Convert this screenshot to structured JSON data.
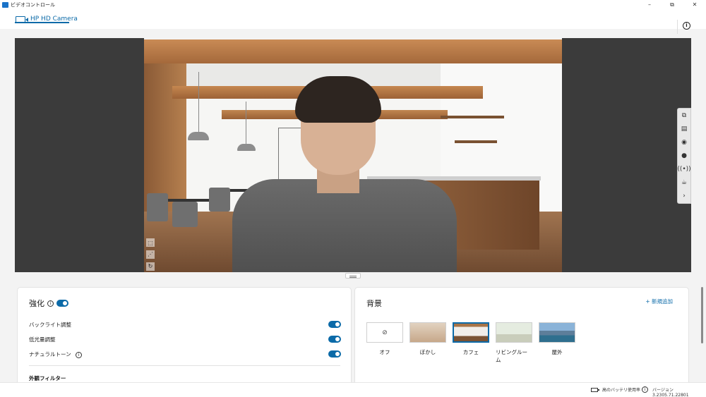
{
  "window": {
    "title": "ビデオコントロール",
    "minimize": "–",
    "maximize": "⧉",
    "close": "✕"
  },
  "tab": {
    "label": "HP HD Camera"
  },
  "header": {
    "info": "i"
  },
  "enhance": {
    "title": "強化",
    "info": "i",
    "enabled": true,
    "settings": [
      {
        "label": "バックライト調整",
        "enabled": true
      },
      {
        "label": "低光量調整",
        "enabled": true
      },
      {
        "label": "ナチュラルトーン",
        "enabled": true,
        "info": "i"
      }
    ],
    "filter_label": "外観フィルター"
  },
  "background": {
    "title": "背景",
    "add_new": "新規追加",
    "add_icon": "+",
    "options": [
      {
        "label": "オフ",
        "icon": "⊘",
        "selected": false
      },
      {
        "label": "ぼかし",
        "icon": "",
        "selected": false
      },
      {
        "label": "カフェ",
        "icon": "",
        "selected": true
      },
      {
        "label": "リビングルーム",
        "icon": "",
        "selected": false
      },
      {
        "label": "屋外",
        "icon": "",
        "selected": false
      }
    ]
  },
  "side_toolbar": {
    "icons": [
      "⧉",
      "▤",
      "◉",
      "●",
      "((•))",
      "☕",
      "›"
    ]
  },
  "left_tools": {
    "icons": [
      "⬚",
      "⋰",
      "↻"
    ]
  },
  "status": {
    "battery_text": "高のバッテリ使用率",
    "info": "i",
    "version": "バージョン 3.2305.71.22801"
  }
}
